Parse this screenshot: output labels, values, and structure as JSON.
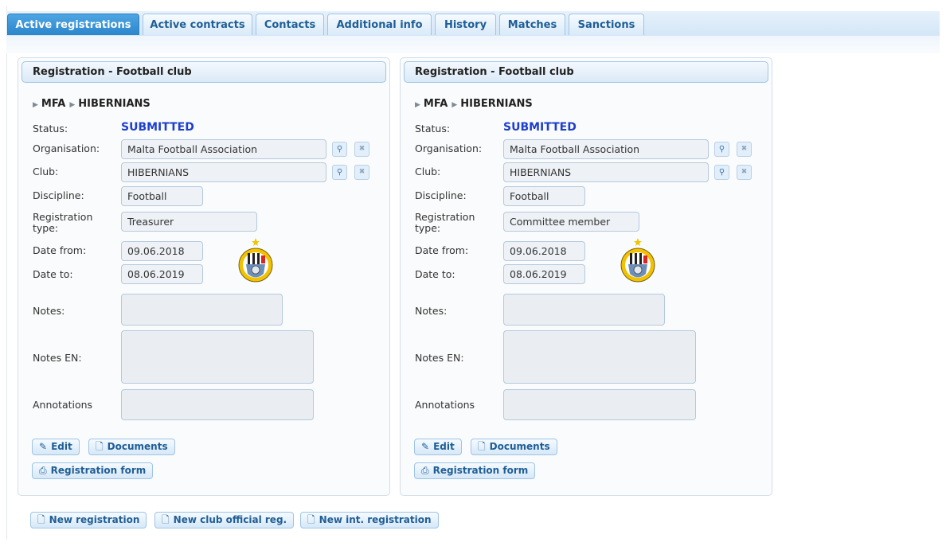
{
  "tabs": [
    {
      "label": "Active registrations",
      "active": true
    },
    {
      "label": "Active contracts"
    },
    {
      "label": "Contacts"
    },
    {
      "label": "Additional info"
    },
    {
      "label": "History"
    },
    {
      "label": "Matches"
    },
    {
      "label": "Sanctions"
    }
  ],
  "panels": [
    {
      "title": "Registration - Football club",
      "crumb1": "MFA",
      "crumb2": "HIBERNIANS",
      "status_label": "Status:",
      "status_value": "SUBMITTED",
      "organisation_label": "Organisation:",
      "organisation_value": "Malta Football Association",
      "club_label": "Club:",
      "club_value": "HIBERNIANS",
      "discipline_label": "Discipline:",
      "discipline_value": "Football",
      "regtype_label_1": "Registration",
      "regtype_label_2": "type:",
      "regtype_value": "Treasurer",
      "date_from_label": "Date from:",
      "date_from_value": "09.06.2018",
      "date_to_label": "Date to:",
      "date_to_value": "08.06.2019",
      "notes_label": "Notes:",
      "notes_en_label": "Notes EN:",
      "annotations_label": "Annotations",
      "edit_label": "Edit",
      "documents_label": "Documents",
      "regform_label": "Registration form"
    },
    {
      "title": "Registration - Football club",
      "crumb1": "MFA",
      "crumb2": "HIBERNIANS",
      "status_label": "Status:",
      "status_value": "SUBMITTED",
      "organisation_label": "Organisation:",
      "organisation_value": "Malta Football Association",
      "club_label": "Club:",
      "club_value": "HIBERNIANS",
      "discipline_label": "Discipline:",
      "discipline_value": "Football",
      "regtype_label_1": "Registration",
      "regtype_label_2": "type:",
      "regtype_value": "Committee member",
      "date_from_label": "Date from:",
      "date_from_value": "09.06.2018",
      "date_to_label": "Date to:",
      "date_to_value": "08.06.2019",
      "notes_label": "Notes:",
      "notes_en_label": "Notes EN:",
      "annotations_label": "Annotations",
      "edit_label": "Edit",
      "documents_label": "Documents",
      "regform_label": "Registration form"
    }
  ],
  "actions": {
    "new_registration": "New registration",
    "new_club_official": "New club official reg.",
    "new_int_registration": "New int. registration"
  },
  "icons": {
    "breadcrumb": "triangle-right-icon",
    "search": "search-icon",
    "clear": "close-icon",
    "edit": "pencil-icon",
    "documents": "document-icon",
    "print": "printer-icon",
    "crest": "club-crest-icon"
  },
  "colors": {
    "accent": "#2c86cb",
    "status": "#1d3fcc",
    "tab_text": "#1f5e96"
  }
}
